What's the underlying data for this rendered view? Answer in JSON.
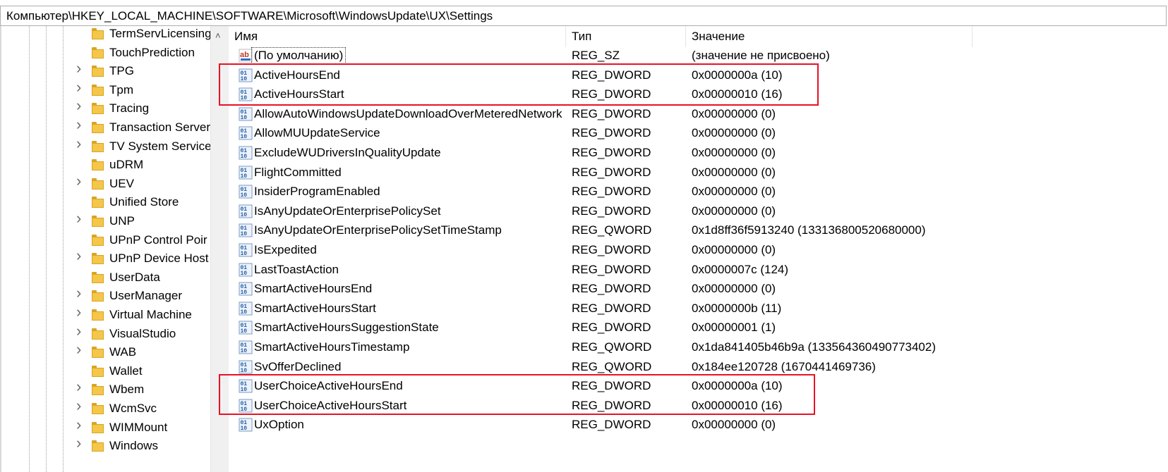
{
  "address": "Компьютер\\HKEY_LOCAL_MACHINE\\SOFTWARE\\Microsoft\\WindowsUpdate\\UX\\Settings",
  "tree": {
    "items": [
      {
        "label": "TermServLicensing",
        "expandable": false
      },
      {
        "label": "TouchPrediction",
        "expandable": false
      },
      {
        "label": "TPG",
        "expandable": true
      },
      {
        "label": "Tpm",
        "expandable": true
      },
      {
        "label": "Tracing",
        "expandable": true
      },
      {
        "label": "Transaction Server",
        "expandable": true
      },
      {
        "label": "TV System Service",
        "expandable": true
      },
      {
        "label": "uDRM",
        "expandable": false
      },
      {
        "label": "UEV",
        "expandable": true
      },
      {
        "label": "Unified Store",
        "expandable": false
      },
      {
        "label": "UNP",
        "expandable": true
      },
      {
        "label": "UPnP Control Poir",
        "expandable": false
      },
      {
        "label": "UPnP Device Host",
        "expandable": true
      },
      {
        "label": "UserData",
        "expandable": false
      },
      {
        "label": "UserManager",
        "expandable": true
      },
      {
        "label": "Virtual Machine",
        "expandable": true
      },
      {
        "label": "VisualStudio",
        "expandable": true
      },
      {
        "label": "WAB",
        "expandable": true
      },
      {
        "label": "Wallet",
        "expandable": false
      },
      {
        "label": "Wbem",
        "expandable": true
      },
      {
        "label": "WcmSvc",
        "expandable": true
      },
      {
        "label": "WIMMount",
        "expandable": true
      },
      {
        "label": "Windows",
        "expandable": true
      }
    ]
  },
  "columns": {
    "name": "Имя",
    "type": "Тип",
    "value": "Значение"
  },
  "values": [
    {
      "name": "(По умолчанию)",
      "type": "REG_SZ",
      "value": "(значение не присвоено)",
      "icon": "string-value-icon"
    },
    {
      "name": "ActiveHoursEnd",
      "type": "REG_DWORD",
      "value": "0x0000000a (10)",
      "icon": "binary-value-icon"
    },
    {
      "name": "ActiveHoursStart",
      "type": "REG_DWORD",
      "value": "0x00000010 (16)",
      "icon": "binary-value-icon"
    },
    {
      "name": "AllowAutoWindowsUpdateDownloadOverMeteredNetwork",
      "type": "REG_DWORD",
      "value": "0x00000000 (0)",
      "icon": "binary-value-icon"
    },
    {
      "name": "AllowMUUpdateService",
      "type": "REG_DWORD",
      "value": "0x00000000 (0)",
      "icon": "binary-value-icon"
    },
    {
      "name": "ExcludeWUDriversInQualityUpdate",
      "type": "REG_DWORD",
      "value": "0x00000000 (0)",
      "icon": "binary-value-icon"
    },
    {
      "name": "FlightCommitted",
      "type": "REG_DWORD",
      "value": "0x00000000 (0)",
      "icon": "binary-value-icon"
    },
    {
      "name": "InsiderProgramEnabled",
      "type": "REG_DWORD",
      "value": "0x00000000 (0)",
      "icon": "binary-value-icon"
    },
    {
      "name": "IsAnyUpdateOrEnterprisePolicySet",
      "type": "REG_DWORD",
      "value": "0x00000000 (0)",
      "icon": "binary-value-icon"
    },
    {
      "name": "IsAnyUpdateOrEnterprisePolicySetTimeStamp",
      "type": "REG_QWORD",
      "value": "0x1d8ff36f5913240 (133136800520680000)",
      "icon": "binary-value-icon"
    },
    {
      "name": "IsExpedited",
      "type": "REG_DWORD",
      "value": "0x00000000 (0)",
      "icon": "binary-value-icon"
    },
    {
      "name": "LastToastAction",
      "type": "REG_DWORD",
      "value": "0x0000007c (124)",
      "icon": "binary-value-icon"
    },
    {
      "name": "SmartActiveHoursEnd",
      "type": "REG_DWORD",
      "value": "0x00000000 (0)",
      "icon": "binary-value-icon"
    },
    {
      "name": "SmartActiveHoursStart",
      "type": "REG_DWORD",
      "value": "0x0000000b (11)",
      "icon": "binary-value-icon"
    },
    {
      "name": "SmartActiveHoursSuggestionState",
      "type": "REG_DWORD",
      "value": "0x00000001 (1)",
      "icon": "binary-value-icon"
    },
    {
      "name": "SmartActiveHoursTimestamp",
      "type": "REG_QWORD",
      "value": "0x1da841405b46b9a (133564360490773402)",
      "icon": "binary-value-icon"
    },
    {
      "name": "SvOfferDeclined",
      "type": "REG_QWORD",
      "value": "0x184ee120728 (1670441469736)",
      "icon": "binary-value-icon"
    },
    {
      "name": "UserChoiceActiveHoursEnd",
      "type": "REG_DWORD",
      "value": "0x0000000a (10)",
      "icon": "binary-value-icon"
    },
    {
      "name": "UserChoiceActiveHoursStart",
      "type": "REG_DWORD",
      "value": "0x00000010 (16)",
      "icon": "binary-value-icon"
    },
    {
      "name": "UxOption",
      "type": "REG_DWORD",
      "value": "0x00000000 (0)",
      "icon": "binary-value-icon"
    }
  ],
  "colors": {
    "highlight": "#e81123",
    "folder": "#f4c64a",
    "binary_icon": "#1f5fa8",
    "string_icon": "#c0392b"
  }
}
